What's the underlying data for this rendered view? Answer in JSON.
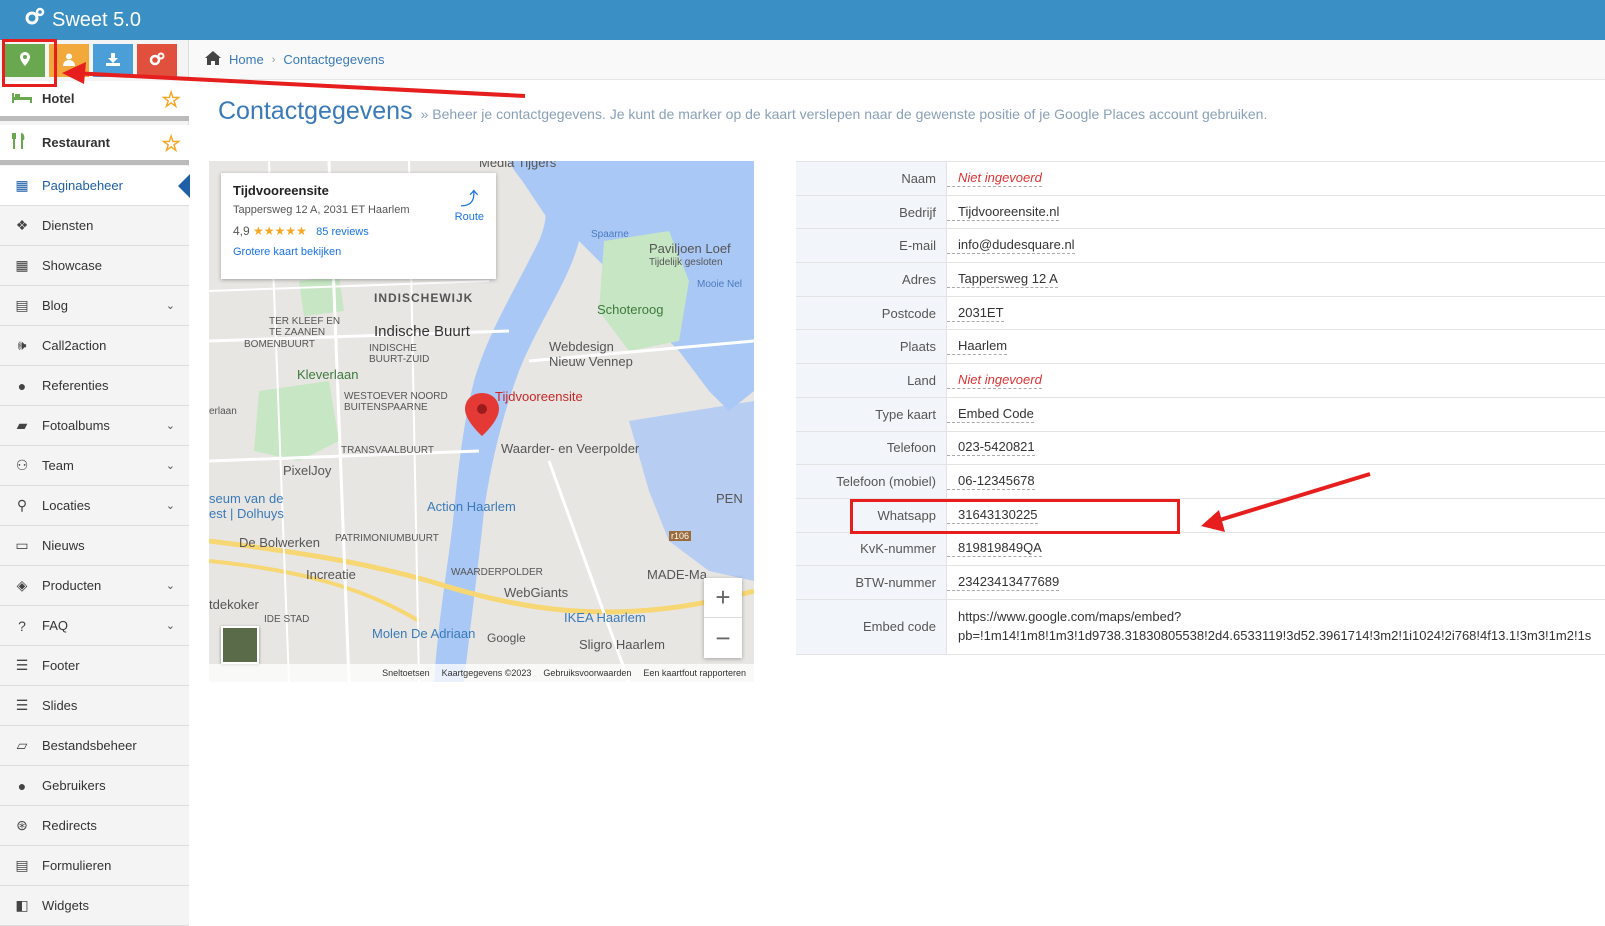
{
  "app": {
    "title": "Sweet 5.0"
  },
  "shortcuts": [
    {
      "icon": "map-marker-icon",
      "color": "#6aa84f"
    },
    {
      "icon": "user-icon",
      "color": "#f2a83b"
    },
    {
      "icon": "download-icon",
      "color": "#4a9fd8"
    },
    {
      "icon": "gears-icon",
      "color": "#e0503c"
    }
  ],
  "favorites": [
    {
      "label": "Hotel"
    },
    {
      "label": "Restaurant"
    }
  ],
  "nav": [
    {
      "label": "Paginabeheer",
      "icon": "table-icon",
      "active": true
    },
    {
      "label": "Diensten",
      "icon": "cubes-icon"
    },
    {
      "label": "Showcase",
      "icon": "grid-icon"
    },
    {
      "label": "Blog",
      "icon": "file-icon",
      "chevron": true
    },
    {
      "label": "Call2action",
      "icon": "volume-icon"
    },
    {
      "label": "Referenties",
      "icon": "comments-icon"
    },
    {
      "label": "Fotoalbums",
      "icon": "book-icon",
      "chevron": true
    },
    {
      "label": "Team",
      "icon": "users-icon",
      "chevron": true
    },
    {
      "label": "Locaties",
      "icon": "map-marker-icon",
      "chevron": true
    },
    {
      "label": "Nieuws",
      "icon": "newspaper-icon"
    },
    {
      "label": "Producten",
      "icon": "tags-icon",
      "chevron": true
    },
    {
      "label": "FAQ",
      "icon": "question-icon",
      "chevron": true
    },
    {
      "label": "Footer",
      "icon": "list-icon"
    },
    {
      "label": "Slides",
      "icon": "sliders-icon"
    },
    {
      "label": "Bestandsbeheer",
      "icon": "folder-icon"
    },
    {
      "label": "Gebruikers",
      "icon": "user-icon"
    },
    {
      "label": "Redirects",
      "icon": "arrow-circle-icon"
    },
    {
      "label": "Formulieren",
      "icon": "form-icon"
    },
    {
      "label": "Widgets",
      "icon": "widget-icon"
    }
  ],
  "breadcrumb": {
    "home": "Home",
    "current": "Contactgegevens"
  },
  "page": {
    "title": "Contactgegevens",
    "subtitle": "» Beheer je contactgegevens. Je kunt de marker op de kaart verslepen naar de gewenste positie of je Google Places account gebruiken."
  },
  "map": {
    "place_name": "Tijdvooreensite",
    "address": "Tappersweg 12 A, 2031 ET Haarlem",
    "rating": "4,9",
    "stars": "★★★★★",
    "reviews": "85 reviews",
    "larger_map": "Grotere kaart bekijken",
    "route": "Route",
    "marker_label": "Tijdvooreensite",
    "labels": {
      "media_tijgers": "Media Tijgers",
      "paviljoen": "Paviljoen Loef",
      "paviljoen_sub": "Tijdelijk gesloten",
      "indischewijk": "INDISCHEWIJK",
      "schoteroog": "Schoteroog",
      "ter_kleef": "TER KLEEF EN\nTE ZAANEN",
      "indische_buurt": "Indische Buurt",
      "bomenbuurt": "BOMENBUURT",
      "indische_zuid": "INDISCHE\nBUURT-ZUID",
      "webdesign": "Webdesign\nNieuw Vennep",
      "kleverlaan": "Kleverlaan",
      "westoever": "WESTOEVER NOORD\nBUITENSPAARNE",
      "waarder": "Waarder- en Veerpolder",
      "transvaal": "TRANSVAALBUURT",
      "pixeljoy": "PixelJoy",
      "museum": "seum van de\nest | Dolhuys",
      "action": "Action Haarlem",
      "bolwerken": "De Bolwerken",
      "patrimonium": "PATRIMONIUMBUURT",
      "incr": "Increatie",
      "waarderpolder": "WAARDERPOLDER",
      "webgiants": "WebGiants",
      "made": "MADE-Ma",
      "ikea": "IKEA Haarlem",
      "dekoker": "tdekoker",
      "molen": "Molen De Adriaan",
      "sligro": "Sligro Haarlem",
      "stad": "IDE STAD",
      "r106": "r106",
      "spaarne": "Spaarne",
      "mooie_nel": "Mooie Nel",
      "pen": "PEN",
      "erlaan": "erlaan",
      "google": "Google"
    },
    "footer": [
      "Sneltoetsen",
      "Kaartgegevens ©2023",
      "Gebruiksvoorwaarden",
      "Een kaartfout rapporteren"
    ]
  },
  "contact": [
    {
      "label": "Naam",
      "value": "Niet ingevoerd",
      "empty": true
    },
    {
      "label": "Bedrijf",
      "value": "Tijdvooreensite.nl"
    },
    {
      "label": "E-mail",
      "value": "info@dudesquare.nl"
    },
    {
      "label": "Adres",
      "value": "Tappersweg 12 A"
    },
    {
      "label": "Postcode",
      "value": "2031ET"
    },
    {
      "label": "Plaats",
      "value": "Haarlem"
    },
    {
      "label": "Land",
      "value": "Niet ingevoerd",
      "empty": true
    },
    {
      "label": "Type kaart",
      "value": "Embed Code"
    },
    {
      "label": "Telefoon",
      "value": "023-5420821"
    },
    {
      "label": "Telefoon (mobiel)",
      "value": "06-12345678"
    },
    {
      "label": "Whatsapp",
      "value": "31643130225"
    },
    {
      "label": "KvK-nummer",
      "value": "819819849QA"
    },
    {
      "label": "BTW-nummer",
      "value": "23423413477689"
    },
    {
      "label": "Embed code",
      "value": "https://www.google.com/maps/embed?",
      "value2": "pb=!1m14!1m8!1m3!1d9738.31830805538!2d4.6533119!3d52.3961714!3m2!1i1024!2i768!4f13.1!3m3!1m2!1s"
    }
  ]
}
